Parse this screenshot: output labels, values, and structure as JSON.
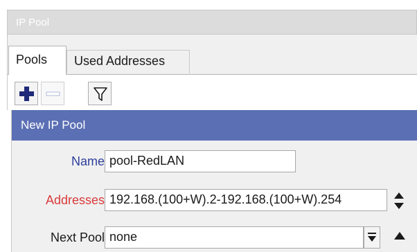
{
  "window": {
    "title": "IP Pool"
  },
  "tabs": [
    {
      "label": "Pools",
      "active": true
    },
    {
      "label": "Used Addresses",
      "active": false
    }
  ],
  "toolbar": {
    "icons": [
      "plus-icon",
      "minus-icon",
      "filter-icon"
    ]
  },
  "dialog": {
    "title": "New IP Pool",
    "fields": {
      "name": {
        "label": "Name:",
        "value": "pool-RedLAN"
      },
      "addresses": {
        "label": "Addresses:",
        "value": "192.168.(100+W).2-192.168.(100+W).254"
      },
      "next_pool": {
        "label": "Next Pool:",
        "value": "none"
      }
    }
  },
  "colors": {
    "header_bar": "#5b6fb4",
    "name_label": "#2f3f9c",
    "addresses_label": "#d93b3b",
    "window_title_bar": "#dcdcdc"
  }
}
